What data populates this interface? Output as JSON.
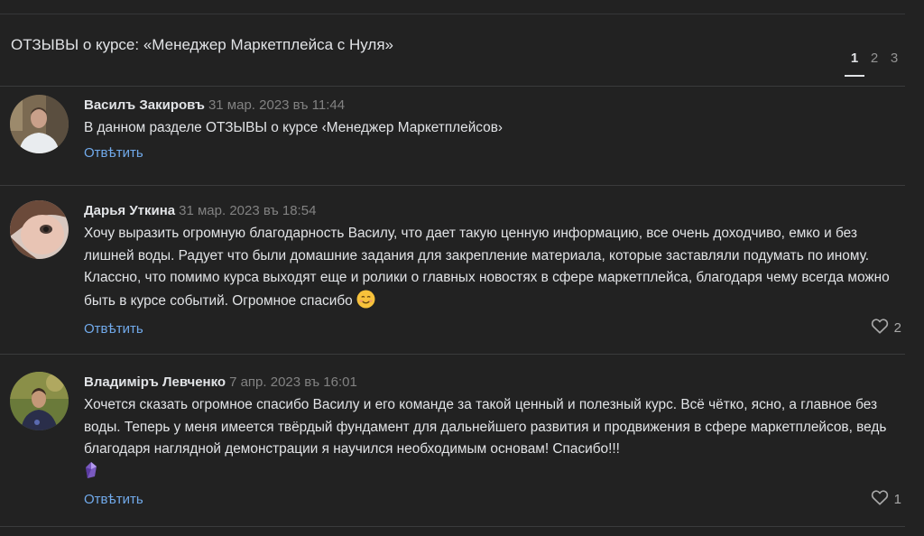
{
  "header": {
    "title": "ОТЗЫВЫ о курсе: «Менеджер Маркетплейса с Нуля»",
    "pages": [
      "1",
      "2",
      "3"
    ],
    "active_page": "1"
  },
  "comments": [
    {
      "author": "Василъ Закировъ",
      "date": "31 мар. 2023 въ 11:44",
      "text": "В данном разделе ОТЗЫВЫ о курсе ‹Менеджер Маркетплейсов›",
      "reply_label": "Отвѣтить"
    },
    {
      "author": "Дарья Уткина",
      "date": "31 мар. 2023 въ 18:54",
      "text": "Хочу выразить огромную благодарность Василу, что дает такую ценную информацию, все очень доходчиво, емко и без лишней воды. Радует что были домашние задания для закрепление материала, которые заставляли подумать по иному. Классно, что помимо курса выходят еще и ролики о главных новостях в сфере маркетплейса, благодаря чему всегда можно быть в курсе событий. Огромное спасибо",
      "reply_label": "Отвѣтить",
      "likes": "2",
      "emoji": "smiling-face-emoji"
    },
    {
      "author": "Владимiръ Левченко",
      "date": "7 апр. 2023 въ 16:01",
      "text": "Хочется сказать огромное спасибо Василу и его команде за такой ценный и полезный курс. Всё чётко, ясно, а главное без воды. Теперь у меня имеется твёрдый фундамент для дальнейшего развития и продвижения в сфере маркетплейсов, ведь благодаря наглядной демонстрации я научился необходимым основам! Спасибо!!!",
      "reply_label": "Отвѣтить",
      "likes": "1",
      "emoji": "purple-crystal-emoji"
    }
  ],
  "colors": {
    "background": "#222222",
    "text": "#e1e3e6",
    "muted": "#828282",
    "link": "#71aaeb",
    "separator": "#3a3b3c"
  }
}
